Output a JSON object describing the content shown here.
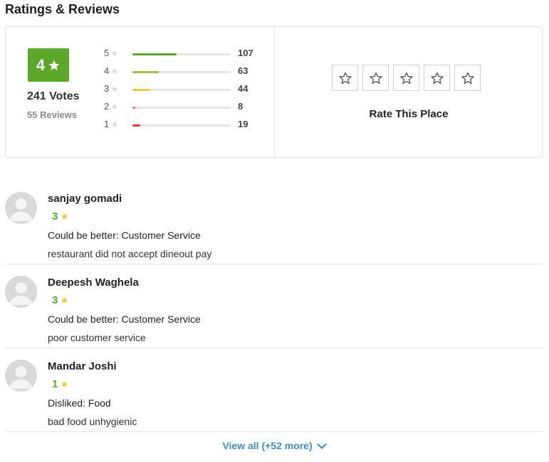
{
  "section_title": "Ratings & Reviews",
  "summary": {
    "score": "4",
    "votes": "241 Votes",
    "reviews": "55 Reviews",
    "distribution": [
      {
        "stars": "5",
        "count": "107",
        "fraction": 1.0,
        "color": "#5ba829"
      },
      {
        "stars": "4",
        "count": "63",
        "fraction": 0.59,
        "color": "#a5c439"
      },
      {
        "stars": "3",
        "count": "44",
        "fraction": 0.41,
        "color": "#f0cb2c"
      },
      {
        "stars": "2",
        "count": "8",
        "fraction": 0.07,
        "color": "#e7883b"
      },
      {
        "stars": "1",
        "count": "19",
        "fraction": 0.18,
        "color": "#d6432f"
      }
    ]
  },
  "rate": {
    "label": "Rate This Place",
    "star_icon": "star-outline-icon"
  },
  "reviews": [
    {
      "name": "sanjay gomadi",
      "rating": "3",
      "tagline": "Could be better: Customer Service",
      "comment": "restaurant did not accept dineout pay"
    },
    {
      "name": "Deepesh Waghela",
      "rating": "3",
      "tagline": "Could be better: Customer Service",
      "comment": "poor customer service"
    },
    {
      "name": "Mandar Joshi",
      "rating": "1",
      "tagline": "Disliked: Food",
      "comment": "bad food unhygienic"
    }
  ],
  "view_all": {
    "label": "View all (+52 more)",
    "icon": "chevron-down-icon"
  },
  "colors": {
    "accent_green": "#5ba829",
    "star_yellow": "#f0cb2c",
    "link_blue": "#3b8ed0"
  }
}
